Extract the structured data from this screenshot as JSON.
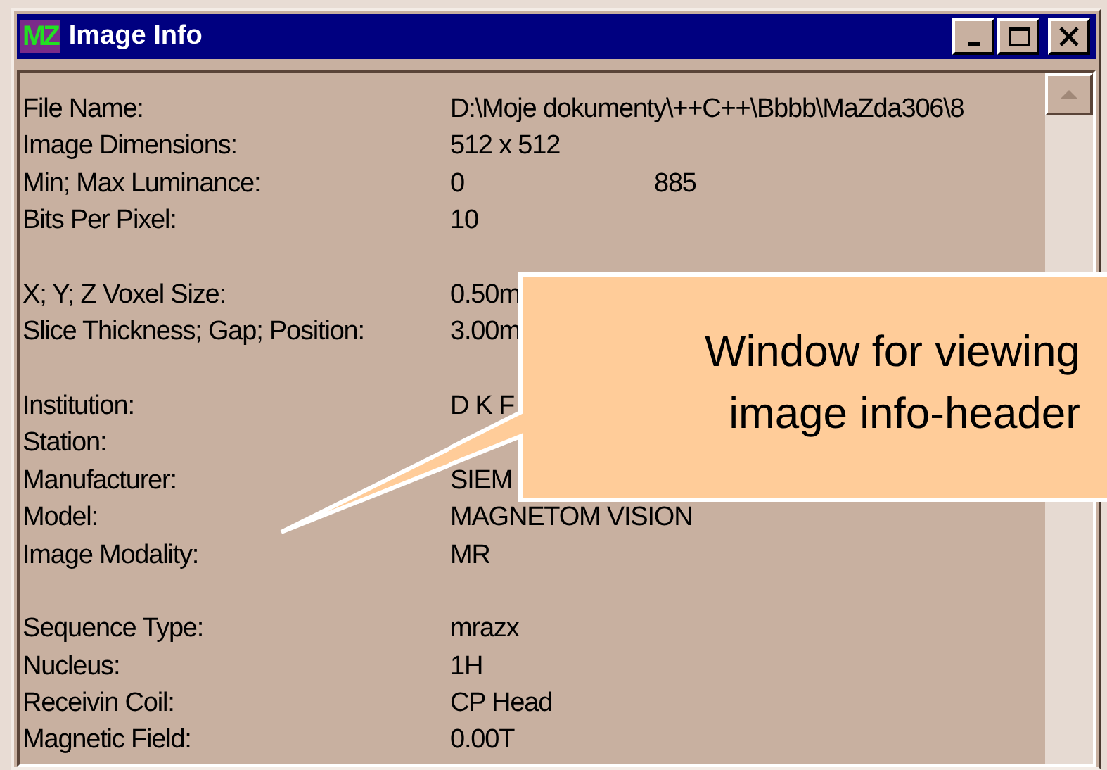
{
  "window": {
    "logo_text": "MZ",
    "title": "Image Info"
  },
  "rows": [
    {
      "kind": "field",
      "label": "File Name:",
      "values": [
        "D:\\Moje dokumenty\\++C++\\Bbbb\\MaZda306\\8"
      ]
    },
    {
      "kind": "field",
      "label": "Image Dimensions:",
      "values": [
        "512 x 512"
      ]
    },
    {
      "kind": "field",
      "label": "Min; Max Luminance:",
      "values": [
        "0",
        "885"
      ]
    },
    {
      "kind": "field",
      "label": "Bits Per Pixel:",
      "values": [
        "10"
      ]
    },
    {
      "kind": "blank"
    },
    {
      "kind": "field",
      "label": "X; Y; Z Voxel Size:",
      "values": [
        "0.50m"
      ]
    },
    {
      "kind": "field",
      "label": "Slice Thickness; Gap; Position:",
      "values": [
        "3.00m"
      ]
    },
    {
      "kind": "blank"
    },
    {
      "kind": "field",
      "label": "Institution:",
      "values": [
        "D K F"
      ]
    },
    {
      "kind": "field",
      "label": "Station:"
    },
    {
      "kind": "field",
      "label": "Manufacturer:",
      "values": [
        "SIEM"
      ]
    },
    {
      "kind": "field",
      "label": "Model:",
      "values": [
        "MAGNETOM VISION"
      ]
    },
    {
      "kind": "field",
      "label": "Image Modality:",
      "values": [
        "MR"
      ]
    },
    {
      "kind": "blank"
    },
    {
      "kind": "field",
      "label": "Sequence Type:",
      "values": [
        "mrazx"
      ]
    },
    {
      "kind": "field",
      "label": "Nucleus:",
      "values": [
        "1H"
      ]
    },
    {
      "kind": "field",
      "label": "Receivin Coil:",
      "values": [
        "CP Head"
      ]
    },
    {
      "kind": "field",
      "label": "Magnetic Field:",
      "values": [
        "0.00T"
      ]
    }
  ],
  "callout": {
    "lines": [
      "Window for viewing",
      "image info-header"
    ]
  }
}
